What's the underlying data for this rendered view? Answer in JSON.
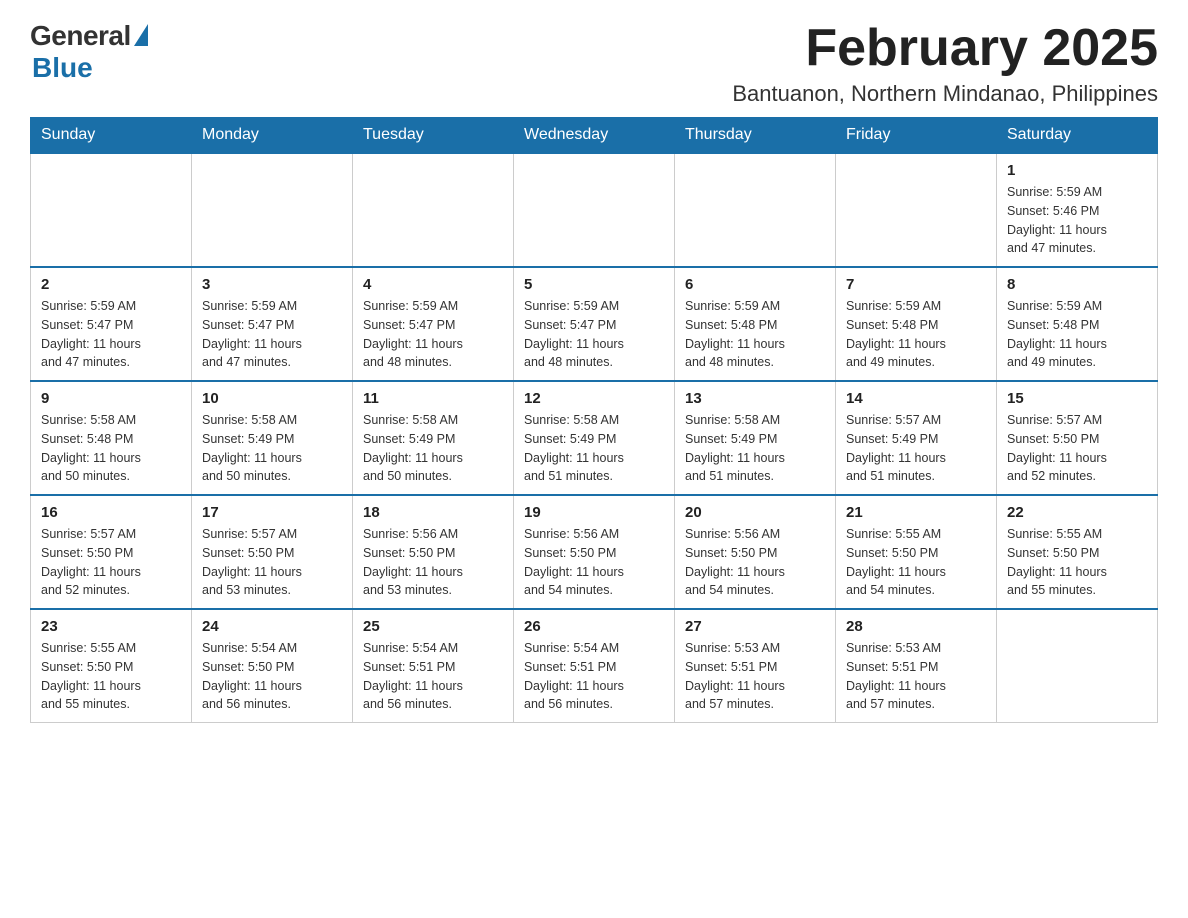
{
  "logo": {
    "general": "General",
    "blue": "Blue"
  },
  "title": {
    "month_year": "February 2025",
    "location": "Bantuanon, Northern Mindanao, Philippines"
  },
  "days_of_week": [
    "Sunday",
    "Monday",
    "Tuesday",
    "Wednesday",
    "Thursday",
    "Friday",
    "Saturday"
  ],
  "weeks": [
    [
      {
        "day": "",
        "info": ""
      },
      {
        "day": "",
        "info": ""
      },
      {
        "day": "",
        "info": ""
      },
      {
        "day": "",
        "info": ""
      },
      {
        "day": "",
        "info": ""
      },
      {
        "day": "",
        "info": ""
      },
      {
        "day": "1",
        "info": "Sunrise: 5:59 AM\nSunset: 5:46 PM\nDaylight: 11 hours\nand 47 minutes."
      }
    ],
    [
      {
        "day": "2",
        "info": "Sunrise: 5:59 AM\nSunset: 5:47 PM\nDaylight: 11 hours\nand 47 minutes."
      },
      {
        "day": "3",
        "info": "Sunrise: 5:59 AM\nSunset: 5:47 PM\nDaylight: 11 hours\nand 47 minutes."
      },
      {
        "day": "4",
        "info": "Sunrise: 5:59 AM\nSunset: 5:47 PM\nDaylight: 11 hours\nand 48 minutes."
      },
      {
        "day": "5",
        "info": "Sunrise: 5:59 AM\nSunset: 5:47 PM\nDaylight: 11 hours\nand 48 minutes."
      },
      {
        "day": "6",
        "info": "Sunrise: 5:59 AM\nSunset: 5:48 PM\nDaylight: 11 hours\nand 48 minutes."
      },
      {
        "day": "7",
        "info": "Sunrise: 5:59 AM\nSunset: 5:48 PM\nDaylight: 11 hours\nand 49 minutes."
      },
      {
        "day": "8",
        "info": "Sunrise: 5:59 AM\nSunset: 5:48 PM\nDaylight: 11 hours\nand 49 minutes."
      }
    ],
    [
      {
        "day": "9",
        "info": "Sunrise: 5:58 AM\nSunset: 5:48 PM\nDaylight: 11 hours\nand 50 minutes."
      },
      {
        "day": "10",
        "info": "Sunrise: 5:58 AM\nSunset: 5:49 PM\nDaylight: 11 hours\nand 50 minutes."
      },
      {
        "day": "11",
        "info": "Sunrise: 5:58 AM\nSunset: 5:49 PM\nDaylight: 11 hours\nand 50 minutes."
      },
      {
        "day": "12",
        "info": "Sunrise: 5:58 AM\nSunset: 5:49 PM\nDaylight: 11 hours\nand 51 minutes."
      },
      {
        "day": "13",
        "info": "Sunrise: 5:58 AM\nSunset: 5:49 PM\nDaylight: 11 hours\nand 51 minutes."
      },
      {
        "day": "14",
        "info": "Sunrise: 5:57 AM\nSunset: 5:49 PM\nDaylight: 11 hours\nand 51 minutes."
      },
      {
        "day": "15",
        "info": "Sunrise: 5:57 AM\nSunset: 5:50 PM\nDaylight: 11 hours\nand 52 minutes."
      }
    ],
    [
      {
        "day": "16",
        "info": "Sunrise: 5:57 AM\nSunset: 5:50 PM\nDaylight: 11 hours\nand 52 minutes."
      },
      {
        "day": "17",
        "info": "Sunrise: 5:57 AM\nSunset: 5:50 PM\nDaylight: 11 hours\nand 53 minutes."
      },
      {
        "day": "18",
        "info": "Sunrise: 5:56 AM\nSunset: 5:50 PM\nDaylight: 11 hours\nand 53 minutes."
      },
      {
        "day": "19",
        "info": "Sunrise: 5:56 AM\nSunset: 5:50 PM\nDaylight: 11 hours\nand 54 minutes."
      },
      {
        "day": "20",
        "info": "Sunrise: 5:56 AM\nSunset: 5:50 PM\nDaylight: 11 hours\nand 54 minutes."
      },
      {
        "day": "21",
        "info": "Sunrise: 5:55 AM\nSunset: 5:50 PM\nDaylight: 11 hours\nand 54 minutes."
      },
      {
        "day": "22",
        "info": "Sunrise: 5:55 AM\nSunset: 5:50 PM\nDaylight: 11 hours\nand 55 minutes."
      }
    ],
    [
      {
        "day": "23",
        "info": "Sunrise: 5:55 AM\nSunset: 5:50 PM\nDaylight: 11 hours\nand 55 minutes."
      },
      {
        "day": "24",
        "info": "Sunrise: 5:54 AM\nSunset: 5:50 PM\nDaylight: 11 hours\nand 56 minutes."
      },
      {
        "day": "25",
        "info": "Sunrise: 5:54 AM\nSunset: 5:51 PM\nDaylight: 11 hours\nand 56 minutes."
      },
      {
        "day": "26",
        "info": "Sunrise: 5:54 AM\nSunset: 5:51 PM\nDaylight: 11 hours\nand 56 minutes."
      },
      {
        "day": "27",
        "info": "Sunrise: 5:53 AM\nSunset: 5:51 PM\nDaylight: 11 hours\nand 57 minutes."
      },
      {
        "day": "28",
        "info": "Sunrise: 5:53 AM\nSunset: 5:51 PM\nDaylight: 11 hours\nand 57 minutes."
      },
      {
        "day": "",
        "info": ""
      }
    ]
  ]
}
